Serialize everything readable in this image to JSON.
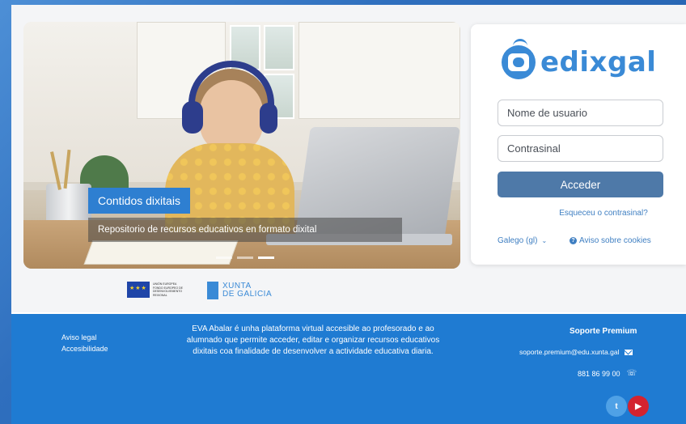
{
  "hero": {
    "caption_title": "Contidos dixitais",
    "caption_subtitle": "Repositorio de recursos educativos en formato dixital",
    "slides_count": 3,
    "active_slide": 3
  },
  "login": {
    "logo_text": "edixgal",
    "username_placeholder": "Nome de usuario",
    "password_placeholder": "Contrasinal",
    "submit_label": "Acceder",
    "forgot_password": "Esqueceu o contrasinal?",
    "language": "Galego (gl)",
    "cookies_notice": "Aviso sobre cookies"
  },
  "partners": {
    "eu_text": "UNIÓN EUROPEA FONDO EUROPEO DE DESENVOLVEMENTO REXIONAL",
    "xunta_line1": "XUNTA",
    "xunta_line2": "DE GALICIA"
  },
  "footer": {
    "links": [
      "Aviso legal",
      "Accesibilidade"
    ],
    "description": "EVA Abalar é unha plataforma virtual accesible ao profesorado e ao alumnado que permite acceder, editar e organizar recursos educativos dixitais coa finalidade de desenvolver a actividade educativa diaria.",
    "support_title": "Soporte Premium",
    "support_email": "soporte.premium@edu.xunta.gal",
    "support_phone": "881 86 99 00"
  },
  "colors": {
    "primary": "#1f7bd2",
    "button": "#4e79a8",
    "link": "#3f7fc2",
    "caption": "#2e7fd1"
  }
}
